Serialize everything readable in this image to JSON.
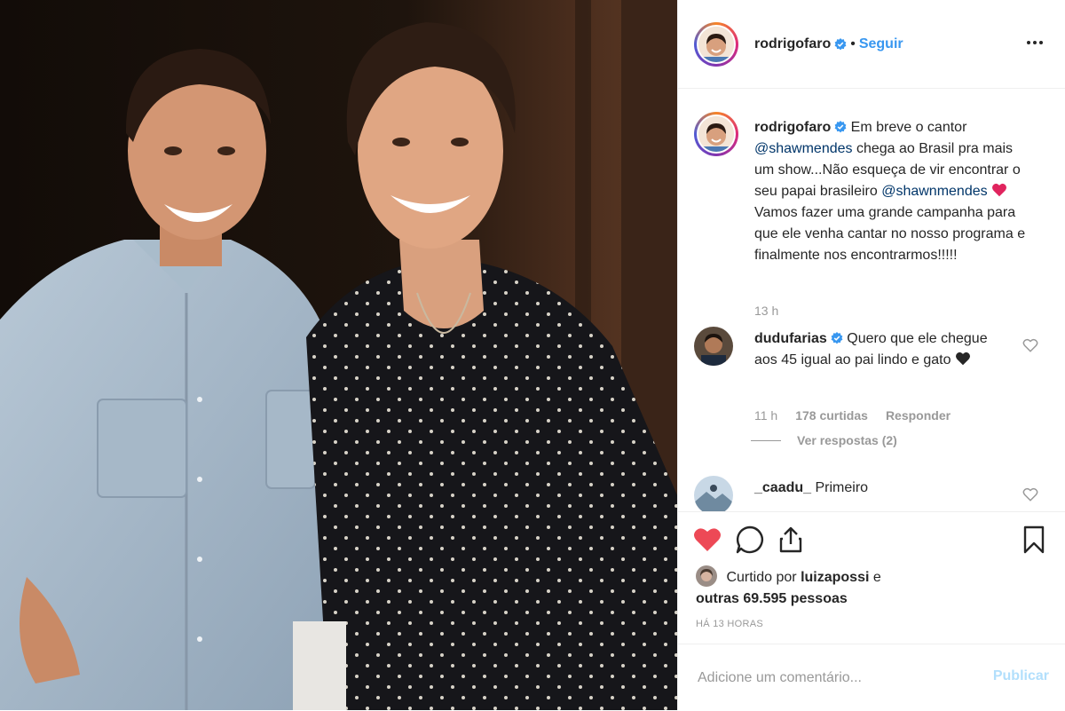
{
  "header": {
    "username": "rodrigofaro",
    "separator": "•",
    "follow_label": "Seguir",
    "more_icon": "more-horizontal-icon"
  },
  "caption": {
    "username": "rodrigofaro",
    "text_1": "Em breve o cantor",
    "mention_1": "@shawmendes",
    "text_2": "chega ao Brasil pra mais um show...Não esqueça de vir encontrar o seu papai brasileiro",
    "mention_2": "@shawnmendes",
    "text_3": "Vamos fazer uma grande campanha para que ele venha cantar no nosso programa e finalmente nos encontrarmos!!!!!",
    "time": "13 h"
  },
  "comments": [
    {
      "username": "dudufarias",
      "text": "Quero que ele chegue aos 45 igual ao pai lindo e gato",
      "time": "11 h",
      "likes": "178 curtidas",
      "reply_label": "Responder",
      "view_replies": "Ver respostas (2)"
    },
    {
      "username": "_caadu_",
      "text": "Primeiro"
    }
  ],
  "actions": {
    "liked_by_prefix": "Curtido por",
    "liked_by_user": "luizapossi",
    "liked_by_suffix": "e",
    "liked_by_others": "outras 69.595 pessoas",
    "timestamp": "HÁ 13 HORAS"
  },
  "add_comment": {
    "placeholder": "Adicione um comentário...",
    "publish_label": "Publicar"
  },
  "colors": {
    "link_blue": "#3897f0",
    "mention_blue": "#003569",
    "like_red": "#ed4956",
    "muted_gray": "#999999",
    "verified_blue": "#3897f0"
  }
}
